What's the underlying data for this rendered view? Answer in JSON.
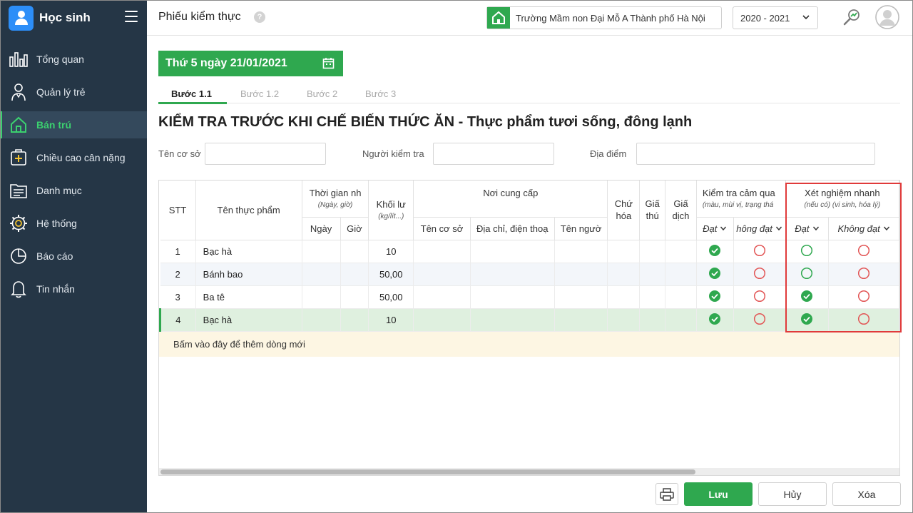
{
  "app": {
    "title": "Học sinh"
  },
  "sidebar": {
    "items": [
      {
        "label": "Tổng quan",
        "icon": "chart-bars-icon"
      },
      {
        "label": "Quản lý trẻ",
        "icon": "child-person-icon"
      },
      {
        "label": "Bán trú",
        "icon": "home-icon",
        "active": true
      },
      {
        "label": "Chiều cao cân nặng",
        "icon": "plus-box-icon"
      },
      {
        "label": "Danh mục",
        "icon": "folder-list-icon"
      },
      {
        "label": "Hệ thống",
        "icon": "gear-icon"
      },
      {
        "label": "Báo cáo",
        "icon": "pie-chart-icon"
      },
      {
        "label": "Tin nhắn",
        "icon": "bell-icon"
      }
    ]
  },
  "header": {
    "page_title": "Phiếu kiểm thực",
    "help": "?",
    "school": "Trường Mầm non Đại Mỗ A Thành phố Hà Nội",
    "year": "2020 - 2021"
  },
  "form": {
    "date": "Thứ 5 ngày 21/01/2021",
    "tabs": [
      "Bước 1.1",
      "Bước 1.2",
      "Bước 2",
      "Bước 3"
    ],
    "active_tab": 0,
    "section_title": "KIỂM TRA TRƯỚC KHI CHẾ BIẾN THỨC ĂN - Thực phẩm tươi sống, đông lạnh",
    "fields": {
      "facility_label": "Tên cơ sở",
      "inspector_label": "Người kiểm tra",
      "location_label": "Địa điểm"
    }
  },
  "table": {
    "headers": {
      "stt": "STT",
      "food_name": "Tên thực phẩm",
      "receive_time": "Thời gian nh",
      "receive_time_sub": "(Ngày, giờ)",
      "date": "Ngày",
      "hour": "Giờ",
      "weight": "Khối lư",
      "weight_sub": "(kg/lít...)",
      "supplier": "Nơi cung cấp",
      "supplier_name": "Tên cơ sở",
      "supplier_address": "Địa chỉ, điện thoạ",
      "supplier_person": "Tên ngườ",
      "signature": "Chứ hóa",
      "cert1": "Giấ thú",
      "cert2": "Giấ dịch",
      "sensory": "Kiểm tra cảm qua",
      "sensory_sub": "(màu, mùi vị, trạng thá",
      "sensory_pass": "Đạt",
      "sensory_fail": "hông đạt",
      "rapid_test": "Xét nghiệm nhanh",
      "rapid_test_sub": "(nếu có) (vi sinh, hóa lý)",
      "rapid_pass": "Đạt",
      "rapid_fail": "Không đạt"
    },
    "rows": [
      {
        "stt": "1",
        "name": "Bạc hà",
        "weight": "10",
        "sensory": "pass",
        "rapid": "pass-empty"
      },
      {
        "stt": "2",
        "name": "Bánh bao",
        "weight": "50,00",
        "sensory": "pass",
        "rapid": "pass-empty"
      },
      {
        "stt": "3",
        "name": "Ba tê",
        "weight": "50,00",
        "sensory": "pass",
        "rapid": "pass"
      },
      {
        "stt": "4",
        "name": "Bạc hà",
        "weight": "10",
        "sensory": "pass",
        "rapid": "pass"
      }
    ],
    "add_row_text": "Bấm vào đây để thêm dòng mới"
  },
  "actions": {
    "save": "Lưu",
    "cancel": "Hủy",
    "delete": "Xóa"
  },
  "colors": {
    "brand": "#2fa84f",
    "sidebar": "#253646",
    "highlight": "#e03a3a",
    "fail": "#e25555"
  }
}
